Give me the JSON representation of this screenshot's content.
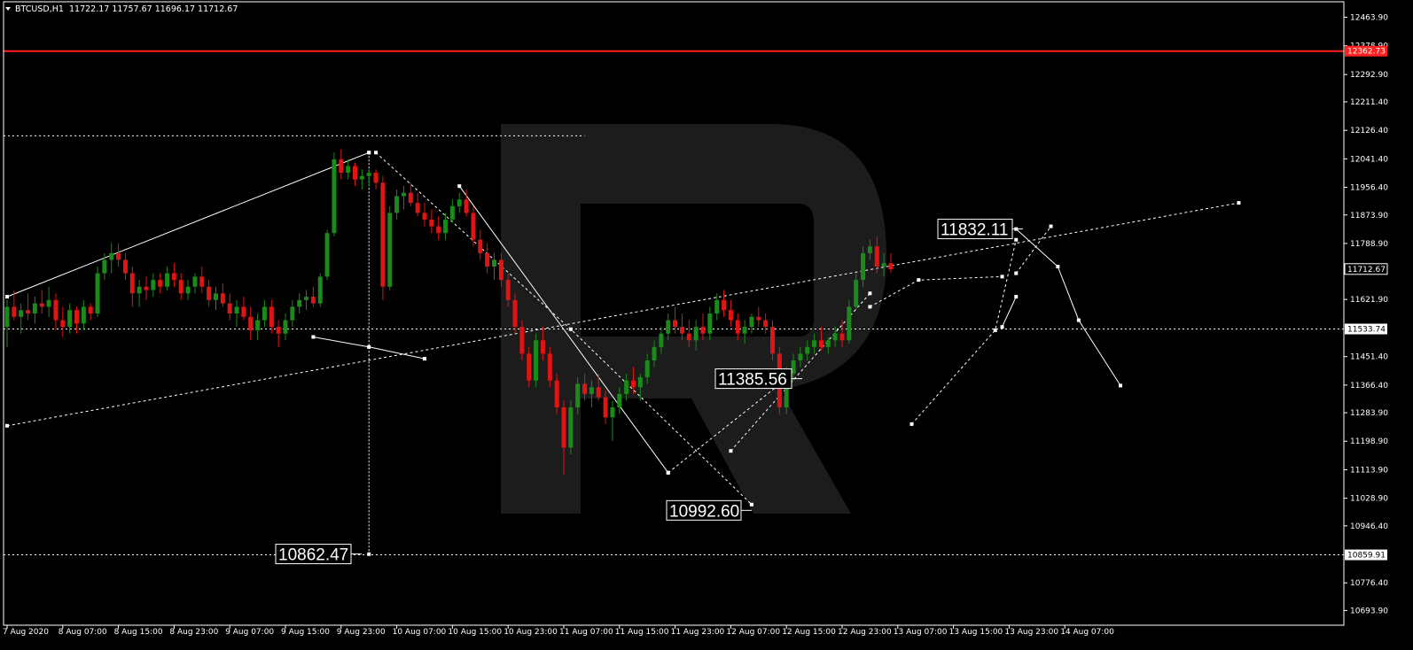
{
  "header": {
    "symbol": "BTCUSD,H1",
    "ohlc": "11722.17 11757.67 11696.17 11712.67"
  },
  "colors": {
    "background": "#000000",
    "bull": "#1a8a1a",
    "bear": "#e01414",
    "grid": "#ffffff",
    "resistance": "#ff2020",
    "text": "#ffffff"
  },
  "chart_data": {
    "type": "candlestick",
    "ylim": [
      10650,
      12510
    ],
    "y_ticks": [
      12463.9,
      12378.9,
      12292.9,
      12211.4,
      12126.4,
      12041.4,
      11956.4,
      11873.9,
      11788.9,
      11621.9,
      11451.4,
      11366.4,
      11283.9,
      11198.9,
      11113.9,
      11028.9,
      10946.4,
      10776.4,
      10693.9
    ],
    "x_ticks": [
      {
        "label": "7 Aug 2020",
        "i": 0
      },
      {
        "label": "8 Aug 07:00",
        "i": 8
      },
      {
        "label": "8 Aug 15:00",
        "i": 16
      },
      {
        "label": "8 Aug 23:00",
        "i": 24
      },
      {
        "label": "9 Aug 07:00",
        "i": 32
      },
      {
        "label": "9 Aug 15:00",
        "i": 40
      },
      {
        "label": "9 Aug 23:00",
        "i": 48
      },
      {
        "label": "10 Aug 07:00",
        "i": 56
      },
      {
        "label": "10 Aug 15:00",
        "i": 64
      },
      {
        "label": "10 Aug 23:00",
        "i": 72
      },
      {
        "label": "11 Aug 07:00",
        "i": 80
      },
      {
        "label": "11 Aug 15:00",
        "i": 88
      },
      {
        "label": "11 Aug 23:00",
        "i": 96
      },
      {
        "label": "12 Aug 07:00",
        "i": 104
      },
      {
        "label": "12 Aug 15:00",
        "i": 112
      },
      {
        "label": "12 Aug 23:00",
        "i": 120
      },
      {
        "label": "13 Aug 07:00",
        "i": 128
      },
      {
        "label": "13 Aug 15:00",
        "i": 136
      },
      {
        "label": "13 Aug 23:00",
        "i": 144
      },
      {
        "label": "14 Aug 07:00",
        "i": 152
      }
    ],
    "candles": [
      [
        11540,
        11620,
        11480,
        11600
      ],
      [
        11600,
        11650,
        11560,
        11570
      ],
      [
        11570,
        11610,
        11520,
        11590
      ],
      [
        11590,
        11640,
        11560,
        11580
      ],
      [
        11580,
        11630,
        11550,
        11610
      ],
      [
        11610,
        11650,
        11580,
        11600
      ],
      [
        11600,
        11660,
        11570,
        11620
      ],
      [
        11620,
        11640,
        11530,
        11560
      ],
      [
        11560,
        11600,
        11510,
        11540
      ],
      [
        11540,
        11610,
        11520,
        11590
      ],
      [
        11590,
        11600,
        11520,
        11550
      ],
      [
        11550,
        11620,
        11530,
        11600
      ],
      [
        11600,
        11610,
        11560,
        11580
      ],
      [
        11580,
        11720,
        11570,
        11700
      ],
      [
        11700,
        11760,
        11680,
        11740
      ],
      [
        11740,
        11790,
        11700,
        11760
      ],
      [
        11760,
        11790,
        11720,
        11740
      ],
      [
        11740,
        11760,
        11680,
        11700
      ],
      [
        11700,
        11720,
        11600,
        11640
      ],
      [
        11640,
        11680,
        11600,
        11660
      ],
      [
        11660,
        11690,
        11620,
        11650
      ],
      [
        11650,
        11700,
        11630,
        11680
      ],
      [
        11680,
        11700,
        11640,
        11660
      ],
      [
        11660,
        11720,
        11650,
        11700
      ],
      [
        11700,
        11730,
        11660,
        11680
      ],
      [
        11680,
        11700,
        11620,
        11640
      ],
      [
        11640,
        11680,
        11620,
        11660
      ],
      [
        11660,
        11700,
        11640,
        11690
      ],
      [
        11690,
        11720,
        11640,
        11660
      ],
      [
        11660,
        11680,
        11600,
        11620
      ],
      [
        11620,
        11660,
        11590,
        11640
      ],
      [
        11640,
        11670,
        11600,
        11610
      ],
      [
        11610,
        11640,
        11560,
        11580
      ],
      [
        11580,
        11620,
        11540,
        11600
      ],
      [
        11600,
        11630,
        11560,
        11570
      ],
      [
        11570,
        11600,
        11500,
        11530
      ],
      [
        11530,
        11580,
        11500,
        11560
      ],
      [
        11560,
        11620,
        11540,
        11600
      ],
      [
        11600,
        11620,
        11520,
        11540
      ],
      [
        11540,
        11560,
        11480,
        11520
      ],
      [
        11520,
        11580,
        11500,
        11560
      ],
      [
        11560,
        11620,
        11540,
        11600
      ],
      [
        11600,
        11640,
        11580,
        11620
      ],
      [
        11620,
        11650,
        11590,
        11630
      ],
      [
        11630,
        11660,
        11600,
        11610
      ],
      [
        11610,
        11700,
        11600,
        11690
      ],
      [
        11690,
        11830,
        11680,
        11820
      ],
      [
        11820,
        12060,
        11810,
        12040
      ],
      [
        12040,
        12070,
        11980,
        12000
      ],
      [
        12000,
        12040,
        11980,
        12020
      ],
      [
        12020,
        12030,
        11960,
        11980
      ],
      [
        11980,
        12010,
        11950,
        11990
      ],
      [
        11990,
        12010,
        11960,
        12000
      ],
      [
        12000,
        12010,
        11950,
        11970
      ],
      [
        11970,
        11990,
        11620,
        11660
      ],
      [
        11660,
        11900,
        11650,
        11880
      ],
      [
        11880,
        11950,
        11860,
        11930
      ],
      [
        11930,
        11960,
        11890,
        11940
      ],
      [
        11940,
        11970,
        11900,
        11910
      ],
      [
        11910,
        11940,
        11870,
        11880
      ],
      [
        11880,
        11910,
        11840,
        11860
      ],
      [
        11860,
        11890,
        11820,
        11840
      ],
      [
        11840,
        11870,
        11800,
        11820
      ],
      [
        11820,
        11880,
        11800,
        11860
      ],
      [
        11860,
        11920,
        11850,
        11900
      ],
      [
        11900,
        11940,
        11880,
        11920
      ],
      [
        11920,
        11950,
        11870,
        11880
      ],
      [
        11880,
        11900,
        11780,
        11800
      ],
      [
        11800,
        11830,
        11740,
        11760
      ],
      [
        11760,
        11790,
        11700,
        11720
      ],
      [
        11720,
        11760,
        11680,
        11740
      ],
      [
        11740,
        11760,
        11660,
        11680
      ],
      [
        11680,
        11700,
        11600,
        11620
      ],
      [
        11620,
        11640,
        11520,
        11540
      ],
      [
        11540,
        11560,
        11440,
        11460
      ],
      [
        11460,
        11480,
        11360,
        11380
      ],
      [
        11380,
        11520,
        11360,
        11500
      ],
      [
        11500,
        11540,
        11440,
        11460
      ],
      [
        11460,
        11480,
        11360,
        11380
      ],
      [
        11380,
        11400,
        11280,
        11300
      ],
      [
        11300,
        11320,
        11100,
        11180
      ],
      [
        11180,
        11320,
        11160,
        11300
      ],
      [
        11300,
        11390,
        11280,
        11370
      ],
      [
        11370,
        11400,
        11320,
        11340
      ],
      [
        11340,
        11380,
        11300,
        11360
      ],
      [
        11360,
        11400,
        11320,
        11330
      ],
      [
        11330,
        11350,
        11250,
        11270
      ],
      [
        11270,
        11320,
        11200,
        11300
      ],
      [
        11300,
        11360,
        11280,
        11340
      ],
      [
        11340,
        11400,
        11320,
        11380
      ],
      [
        11380,
        11420,
        11340,
        11360
      ],
      [
        11360,
        11400,
        11320,
        11390
      ],
      [
        11390,
        11460,
        11370,
        11440
      ],
      [
        11440,
        11500,
        11420,
        11480
      ],
      [
        11480,
        11540,
        11460,
        11520
      ],
      [
        11520,
        11580,
        11500,
        11560
      ],
      [
        11560,
        11600,
        11520,
        11540
      ],
      [
        11540,
        11580,
        11500,
        11520
      ],
      [
        11520,
        11560,
        11480,
        11500
      ],
      [
        11500,
        11560,
        11470,
        11540
      ],
      [
        11540,
        11580,
        11500,
        11520
      ],
      [
        11520,
        11600,
        11500,
        11580
      ],
      [
        11580,
        11640,
        11560,
        11620
      ],
      [
        11620,
        11650,
        11570,
        11590
      ],
      [
        11590,
        11620,
        11540,
        11560
      ],
      [
        11560,
        11580,
        11500,
        11520
      ],
      [
        11520,
        11560,
        11490,
        11540
      ],
      [
        11540,
        11580,
        11520,
        11570
      ],
      [
        11570,
        11600,
        11540,
        11560
      ],
      [
        11560,
        11580,
        11520,
        11540
      ],
      [
        11540,
        11560,
        11440,
        11460
      ],
      [
        11460,
        11480,
        11280,
        11300
      ],
      [
        11300,
        11420,
        11280,
        11400
      ],
      [
        11400,
        11460,
        11380,
        11440
      ],
      [
        11440,
        11480,
        11420,
        11460
      ],
      [
        11460,
        11500,
        11440,
        11480
      ],
      [
        11480,
        11520,
        11460,
        11500
      ],
      [
        11500,
        11540,
        11470,
        11480
      ],
      [
        11480,
        11510,
        11460,
        11500
      ],
      [
        11500,
        11540,
        11480,
        11520
      ],
      [
        11520,
        11560,
        11480,
        11500
      ],
      [
        11500,
        11620,
        11490,
        11600
      ],
      [
        11600,
        11700,
        11590,
        11680
      ],
      [
        11680,
        11780,
        11660,
        11760
      ],
      [
        11760,
        11800,
        11740,
        11780
      ],
      [
        11780,
        11810,
        11700,
        11720
      ],
      [
        11720,
        11760,
        11690,
        11730
      ],
      [
        11730,
        11760,
        11700,
        11712
      ]
    ],
    "h_lines": [
      {
        "kind": "resistance",
        "y": 12362.73,
        "style": "solid"
      },
      {
        "kind": "level-top",
        "y": 12110,
        "style": "dotted",
        "x_end_i": 83
      },
      {
        "kind": "level-mid",
        "y": 11533.74,
        "style": "dotted"
      },
      {
        "kind": "level-low",
        "y": 10859.91,
        "style": "dotted"
      }
    ],
    "price_tags": [
      {
        "y": 12362.73,
        "label": "12362.73",
        "bg": "#ff2020",
        "fg": "#ffffff"
      },
      {
        "y": 11712.67,
        "label": "11712.67",
        "bg": "#000000",
        "fg": "#ffffff"
      },
      {
        "y": 11533.74,
        "label": "11533.74",
        "bg": "#ffffff",
        "fg": "#000000"
      },
      {
        "y": 10859.91,
        "label": "10859.91",
        "bg": "#ffffff",
        "fg": "#000000"
      }
    ],
    "callouts": [
      {
        "label": "11832.11",
        "y": 11832.11
      },
      {
        "label": "11385.56",
        "y": 11385.56
      },
      {
        "label": "10992.60",
        "y": 10992.6
      },
      {
        "label": "10862.47",
        "y": 10862.47
      }
    ]
  }
}
